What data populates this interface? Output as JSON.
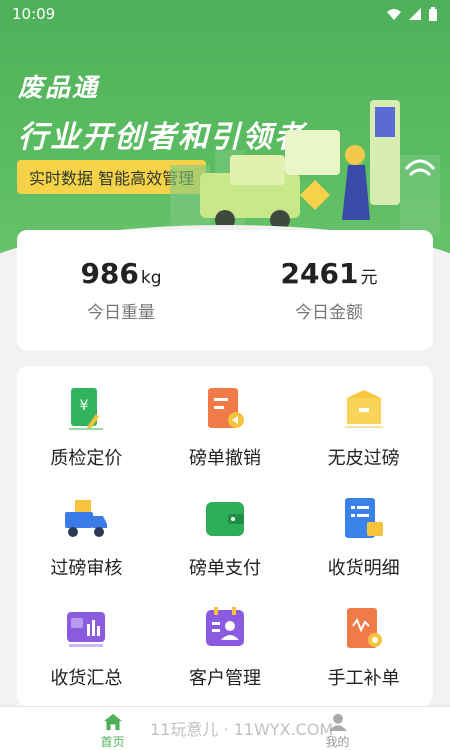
{
  "status_bar": {
    "time": "10:09"
  },
  "banner": {
    "title": "废品通",
    "slogan": "行业开创者和引领者",
    "tag": "实时数据 智能高效管理"
  },
  "stats": [
    {
      "value": "986",
      "unit": "kg",
      "label": "今日重量"
    },
    {
      "value": "2461",
      "unit": "元",
      "label": "今日金额"
    }
  ],
  "menu": [
    {
      "label": "质检定价",
      "icon": "pricing-icon"
    },
    {
      "label": "磅单撤销",
      "icon": "revoke-icon"
    },
    {
      "label": "无皮过磅",
      "icon": "box-icon"
    },
    {
      "label": "过磅审核",
      "icon": "truck-icon"
    },
    {
      "label": "磅单支付",
      "icon": "wallet-icon"
    },
    {
      "label": "收货明细",
      "icon": "detail-icon"
    },
    {
      "label": "收货汇总",
      "icon": "summary-icon"
    },
    {
      "label": "客户管理",
      "icon": "customer-icon"
    },
    {
      "label": "手工补单",
      "icon": "manual-order-icon"
    }
  ],
  "tabs": [
    {
      "label": "首页",
      "icon": "home-icon",
      "active": true
    },
    {
      "label": "我的",
      "icon": "user-icon",
      "active": false
    }
  ],
  "watermark": "11玩意儿 · 11WYX.COM",
  "colors": {
    "primary": "#4fb05a",
    "tag_bg": "#f6d248"
  }
}
